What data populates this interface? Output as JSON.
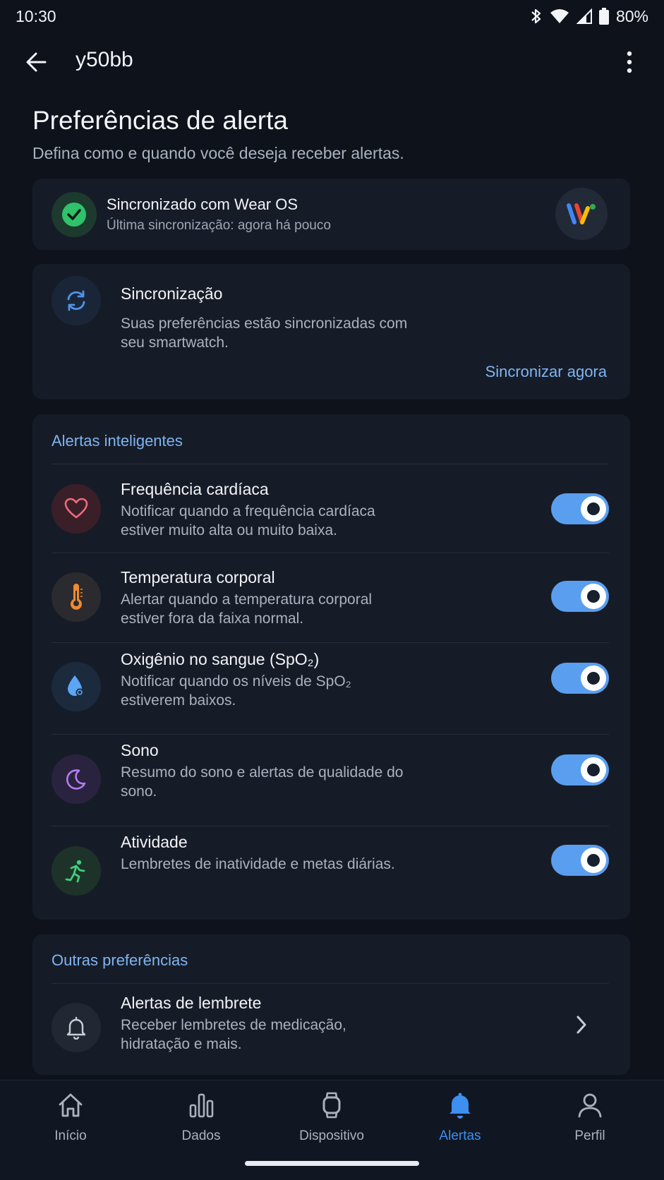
{
  "status_bar": {
    "time": "10:30",
    "battery": "80%"
  },
  "app_bar": {
    "title": "y50bb"
  },
  "header": {
    "title": "Preferências de alerta",
    "subtitle": "Defina como e quando você deseja receber alertas."
  },
  "sync_status": {
    "title": "Sincronizado com Wear OS",
    "subtitle": "Última sincronização: agora há pouco"
  },
  "sync_card": {
    "title": "Sincronização",
    "description": "Suas preferências estão sincronizadas com seu smartwatch.",
    "action": "Sincronizar agora"
  },
  "smart_alerts": {
    "section_title": "Alertas inteligentes",
    "items": [
      {
        "title": "Frequência cardíaca",
        "description": "Notificar quando a frequência cardíaca estiver muito alta ou muito baixa.",
        "enabled": true,
        "icon": "heart-icon"
      },
      {
        "title": "Temperatura corporal",
        "description": "Alertar quando a temperatura corporal estiver fora da faixa normal.",
        "enabled": true,
        "icon": "thermometer-icon"
      },
      {
        "title": "Oxigênio no sangue (SpO₂)",
        "description": "Notificar quando os níveis de SpO₂ estiverem baixos.",
        "enabled": true,
        "icon": "blood-drop-icon"
      },
      {
        "title": "Sono",
        "description": "Resumo do sono e alertas de qualidade do sono.",
        "enabled": true,
        "icon": "moon-icon"
      },
      {
        "title": "Atividade",
        "description": "Lembretes de inatividade e metas diárias.",
        "enabled": true,
        "icon": "running-icon"
      }
    ]
  },
  "other_prefs": {
    "section_title": "Outras preferências",
    "items": [
      {
        "title": "Alertas de lembrete",
        "description": "Receber lembretes de medicação, hidratação e mais.",
        "icon": "bell-icon"
      }
    ]
  },
  "bottom_nav": {
    "items": [
      {
        "label": "Início",
        "icon": "home-icon"
      },
      {
        "label": "Dados",
        "icon": "bar-chart-icon"
      },
      {
        "label": "Dispositivo",
        "icon": "watch-icon"
      },
      {
        "label": "Alertas",
        "icon": "bell-icon",
        "active": true
      },
      {
        "label": "Perfil",
        "icon": "person-icon"
      }
    ]
  },
  "colors": {
    "accent": "#3d8ff0",
    "toggle_on": "#5a9ef0",
    "background": "#0d121b",
    "card": "#161c27"
  }
}
